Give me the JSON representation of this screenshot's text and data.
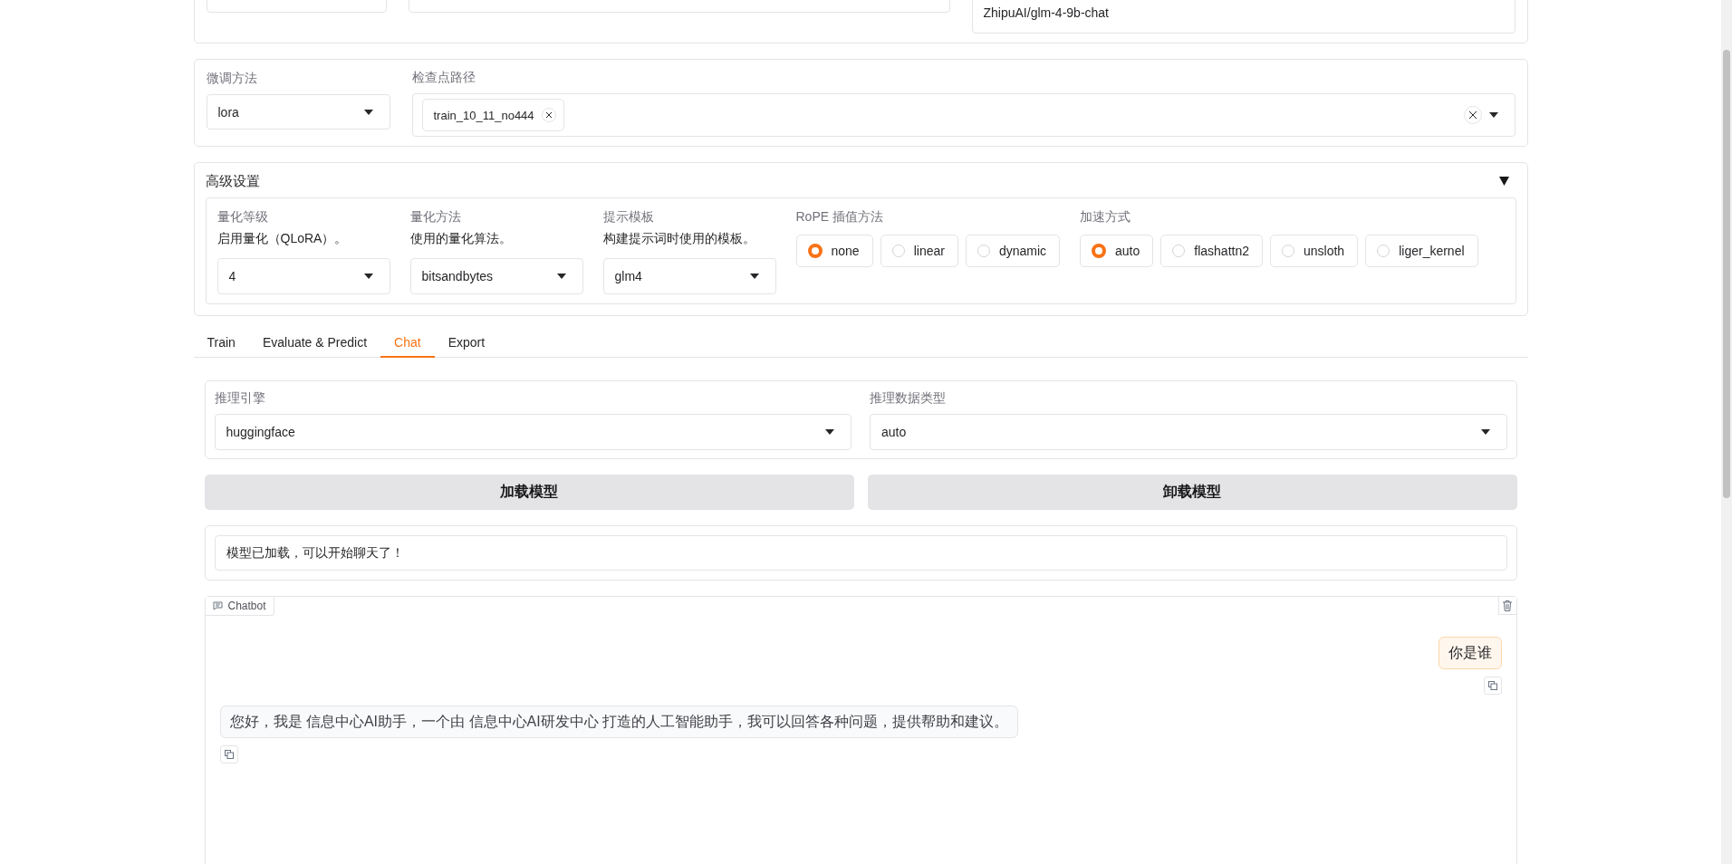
{
  "top_row": {
    "model_path": "ZhipuAI/glm-4-9b-chat"
  },
  "finetune": {
    "method_label": "微调方法",
    "method": "lora",
    "checkpoint_label": "检查点路径",
    "checkpoints": [
      "train_10_11_no444"
    ]
  },
  "advanced": {
    "title": "高级设置",
    "expanded": true,
    "dropdowns": [
      {
        "label": "量化等级",
        "info": "启用量化（QLoRA）。",
        "value": "4"
      },
      {
        "label": "量化方法",
        "info": "使用的量化算法。",
        "value": "bitsandbytes"
      },
      {
        "label": "提示模板",
        "info": "构建提示词时使用的模板。",
        "value": "glm4"
      }
    ],
    "radio_groups": [
      {
        "label": "RoPE 插值方法",
        "options": [
          {
            "label": "none",
            "selected": true
          },
          {
            "label": "linear",
            "selected": false
          },
          {
            "label": "dynamic",
            "selected": false
          }
        ]
      },
      {
        "label": "加速方式",
        "options": [
          {
            "label": "auto",
            "selected": true
          },
          {
            "label": "flashattn2",
            "selected": false
          },
          {
            "label": "unsloth",
            "selected": false
          },
          {
            "label": "liger_kernel",
            "selected": false
          }
        ]
      }
    ]
  },
  "tabs": [
    {
      "label": "Train",
      "selected": false
    },
    {
      "label": "Evaluate & Predict",
      "selected": false
    },
    {
      "label": "Chat",
      "selected": true
    },
    {
      "label": "Export",
      "selected": false
    }
  ],
  "chat": {
    "dropdowns": [
      {
        "label": "推理引擎",
        "value": "huggingface"
      },
      {
        "label": "推理数据类型",
        "value": "auto"
      }
    ],
    "buttons": [
      "加载模型",
      "卸载模型"
    ],
    "status": "模型已加载，可以开始聊天了！",
    "chatbot": {
      "label": "Chatbot",
      "messages": [
        {
          "kind": "user",
          "text": "你是谁"
        },
        {
          "kind": "assistant",
          "text": "您好，我是 信息中心AI助手，一个由 信息中心AI研发中心 打造的人工智能助手，我可以回答各种问题，提供帮助和建议。"
        }
      ]
    }
  }
}
